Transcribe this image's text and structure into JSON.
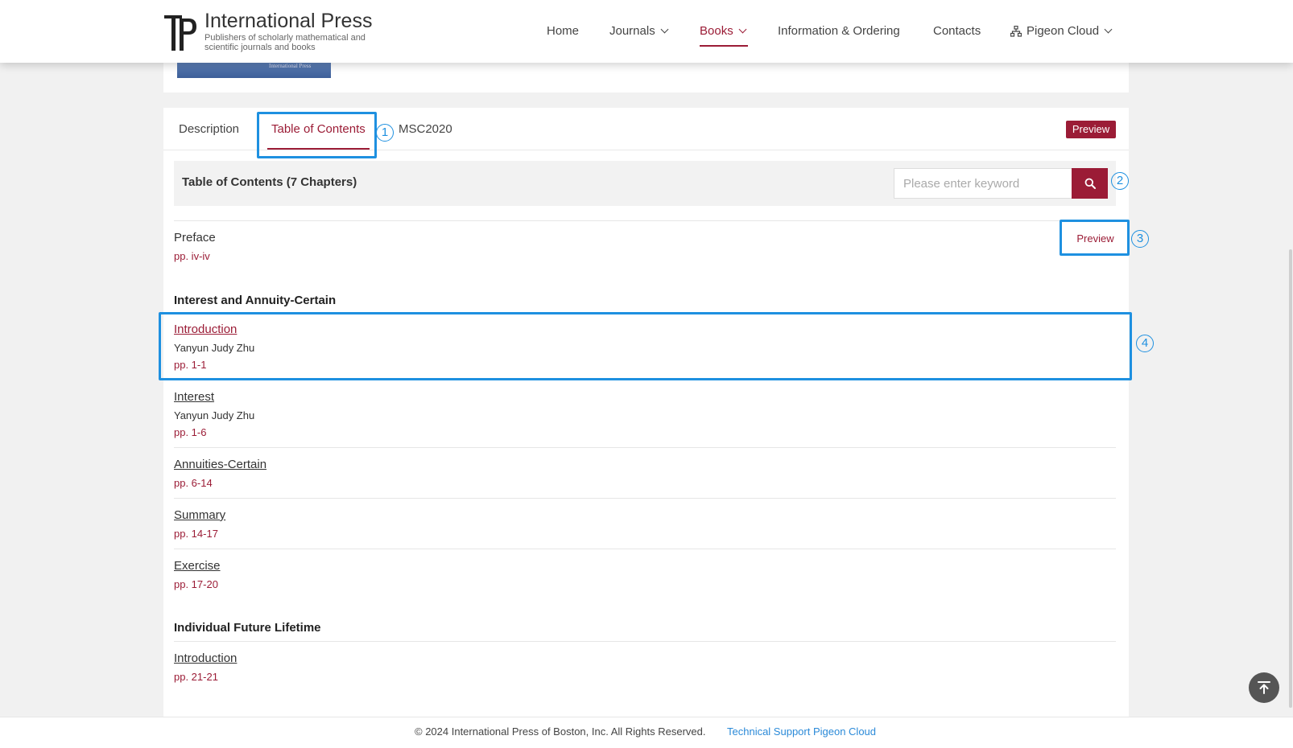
{
  "brand": {
    "title": "International Press",
    "subtitle": "Publishers of scholarly mathematical and scientific journals and books"
  },
  "nav": {
    "home": "Home",
    "journals": "Journals",
    "books": "Books",
    "info": "Information & Ordering",
    "contacts": "Contacts",
    "pigeon": "Pigeon Cloud"
  },
  "cover": {
    "text": "International Press"
  },
  "tabs": {
    "description": "Description",
    "toc": "Table of Contents",
    "msc": "MSC2020",
    "preview": "Preview"
  },
  "toc": {
    "title": "Table of Contents (7 Chapters)",
    "search_placeholder": "Please enter keyword"
  },
  "preface": {
    "title": "Preface",
    "pages": "pp. iv-iv",
    "preview": "Preview"
  },
  "sections": [
    {
      "heading": "Interest and Annuity-Certain",
      "entries": [
        {
          "title": "Introduction",
          "author": "Yanyun Judy Zhu",
          "pages": "pp. 1-1"
        },
        {
          "title": "Interest",
          "author": "Yanyun Judy Zhu",
          "pages": "pp. 1-6"
        },
        {
          "title": "Annuities-Certain",
          "pages": "pp. 6-14"
        },
        {
          "title": "Summary",
          "pages": "pp. 14-17"
        },
        {
          "title": "Exercise",
          "pages": "pp. 17-20"
        }
      ]
    },
    {
      "heading": "Individual Future Lifetime",
      "entries": [
        {
          "title": "Introduction",
          "pages": "pp. 21-21"
        }
      ]
    }
  ],
  "annotations": [
    "1",
    "2",
    "3",
    "4"
  ],
  "footer": {
    "copyright": "© 2024 International Press of Boston, Inc. All Rights Reserved.",
    "support": "Technical Support Pigeon Cloud"
  },
  "colors": {
    "accent": "#9b1c36",
    "annotation": "#1e90e0",
    "link": "#2b8ad8"
  }
}
